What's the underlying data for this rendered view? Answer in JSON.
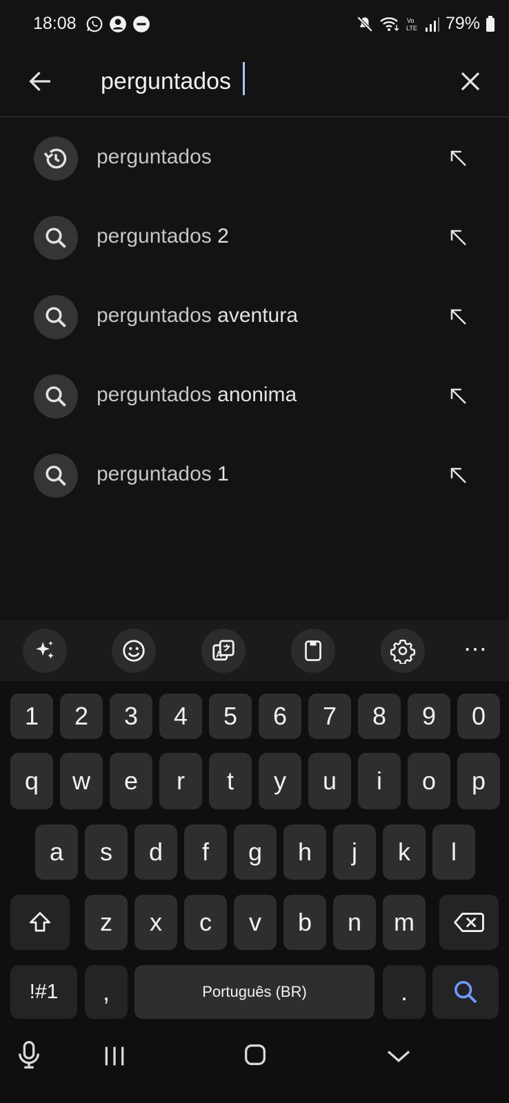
{
  "status_bar": {
    "time": "18:08",
    "battery": "79%",
    "icons": [
      "whatsapp-icon",
      "account-icon",
      "dnd-icon",
      "mute-icon",
      "wifi-icon",
      "volte-icon",
      "signal-icon",
      "battery-icon"
    ]
  },
  "search": {
    "query": "perguntados",
    "back_icon": "arrow-back-icon",
    "clear_icon": "close-icon"
  },
  "suggestions": [
    {
      "icon": "history-icon",
      "prefix": "perguntados",
      "suffix": ""
    },
    {
      "icon": "search-icon",
      "prefix": "perguntados",
      "suffix": " 2"
    },
    {
      "icon": "search-icon",
      "prefix": "perguntados",
      "suffix": " aventura"
    },
    {
      "icon": "search-icon",
      "prefix": "perguntados",
      "suffix": " anonima"
    },
    {
      "icon": "search-icon",
      "prefix": "perguntados",
      "suffix": " 1"
    }
  ],
  "keyboard": {
    "toolbar": [
      "sparkle-icon",
      "emoji-icon",
      "translate-icon",
      "clipboard-icon",
      "settings-icon",
      "more-icon"
    ],
    "more_label": "⋯",
    "row_numbers": [
      "1",
      "2",
      "3",
      "4",
      "5",
      "6",
      "7",
      "8",
      "9",
      "0"
    ],
    "row1": [
      "q",
      "w",
      "e",
      "r",
      "t",
      "y",
      "u",
      "i",
      "o",
      "p"
    ],
    "row2": [
      "a",
      "s",
      "d",
      "f",
      "g",
      "h",
      "j",
      "k",
      "l"
    ],
    "row3": [
      "z",
      "x",
      "c",
      "v",
      "b",
      "n",
      "m"
    ],
    "symbols_label": "!#1",
    "comma_label": ",",
    "space_label": "Português (BR)",
    "period_label": ".",
    "accent_color": "#6e9bff"
  },
  "nav_bar": {
    "icons": [
      "mic-icon",
      "recents-icon",
      "home-icon",
      "hide-keyboard-icon"
    ]
  }
}
